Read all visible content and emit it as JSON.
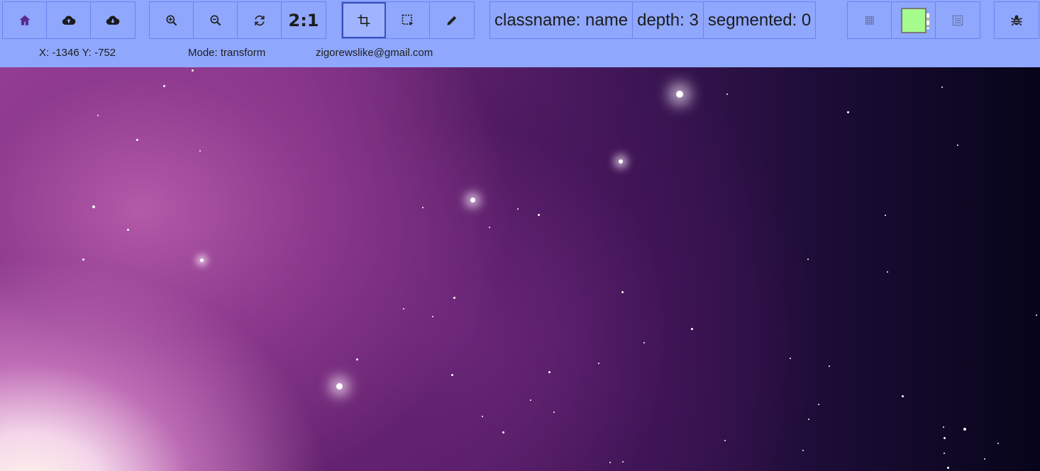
{
  "toolbar": {
    "file_group": [
      {
        "name": "home-icon",
        "label": "Home"
      },
      {
        "name": "cloud-upload-icon",
        "label": "Upload"
      },
      {
        "name": "cloud-download-icon",
        "label": "Download"
      }
    ],
    "view_group": [
      {
        "name": "zoom-in-icon"
      },
      {
        "name": "zoom-out-icon"
      },
      {
        "name": "reset-view-icon"
      }
    ],
    "ratio_label": "2:1",
    "mode_group": [
      {
        "name": "crop-icon",
        "active": true
      },
      {
        "name": "select-region-icon",
        "active": false
      },
      {
        "name": "pencil-icon",
        "active": false
      }
    ],
    "info": {
      "classname": "classname: name",
      "depth": "depth: 3",
      "segmented": "segmented: 0"
    },
    "display_group": [
      {
        "name": "grid-dense-icon"
      },
      {
        "name": "color-swatch",
        "color": "#a6fb8d"
      },
      {
        "name": "grid-sparse-icon"
      }
    ],
    "debug": {
      "name": "bug-icon"
    }
  },
  "status": {
    "coords": "X: -1346 Y: -752",
    "mode": "Mode: transform",
    "user": "zigorewslike@gmail.com"
  },
  "colors": {
    "toolbar_bg": "#8fa7fc",
    "border": "#6b84f0",
    "accent_icon": "#5a2a8e",
    "swatch": "#a6fb8d"
  }
}
